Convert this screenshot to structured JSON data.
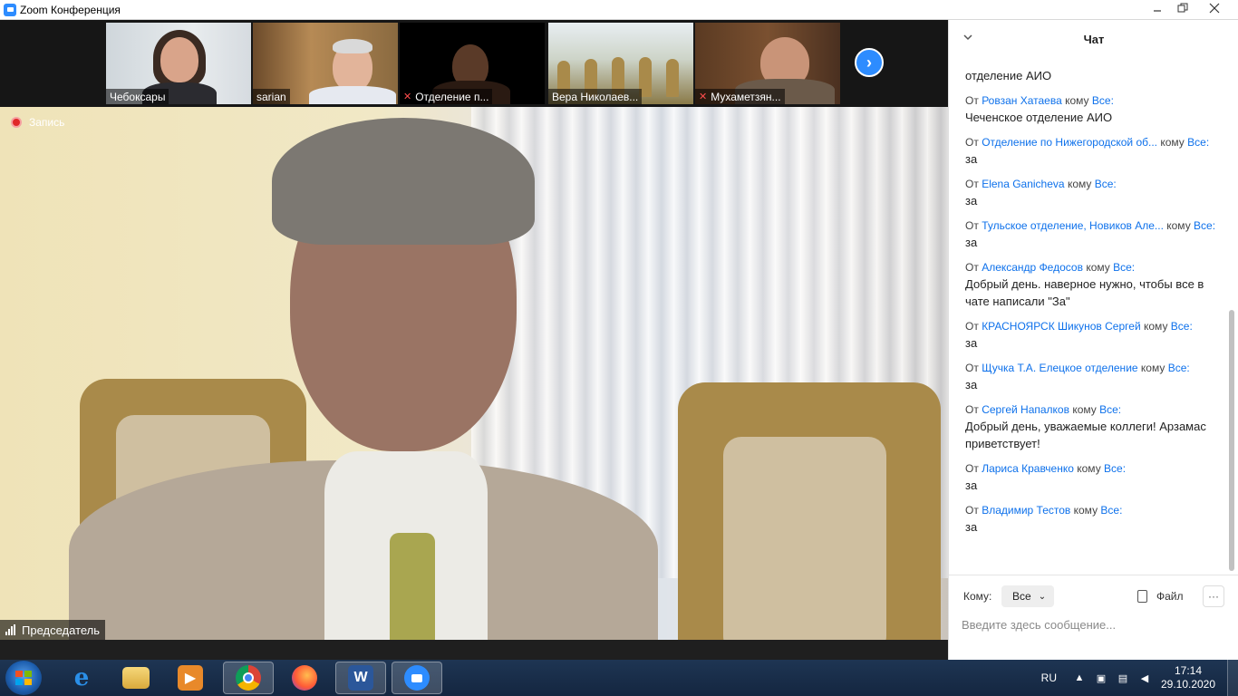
{
  "window": {
    "title": "Zoom Конференция"
  },
  "colors": {
    "accent": "#2d8cff",
    "link": "#0e71eb",
    "record": "#e02828",
    "taskbar": "#1e3553"
  },
  "participants": [
    {
      "name": "Чебоксары",
      "muted": false
    },
    {
      "name": "sarian",
      "muted": false
    },
    {
      "name": "Отделение п...",
      "muted": true
    },
    {
      "name": "Вера Николаев...",
      "muted": false
    },
    {
      "name": "Мухаметзян...",
      "muted": true
    }
  ],
  "main_video": {
    "recording_label": "Запись",
    "speaker_label": "Председатель"
  },
  "chat": {
    "title": "Чат",
    "partial_top": "отделение АИО",
    "from_word": "От",
    "to_word": "кому",
    "messages": [
      {
        "from": "Ровзан Хатаева",
        "to": "Все:",
        "text": "Чеченское отделение АИО"
      },
      {
        "from": "Отделение по Нижегородской об...",
        "to": "Все:",
        "text": "за"
      },
      {
        "from": "Elena Ganicheva",
        "to": "Все:",
        "text": "за"
      },
      {
        "from": "Тульское отделение, Новиков Але...",
        "to": "Все:",
        "text": "за"
      },
      {
        "from": "Александр Федосов",
        "to": "Все:",
        "text": "Добрый день. наверное нужно, чтобы все в чате написали \"За\""
      },
      {
        "from": "КРАСНОЯРСК Шикунов Сергей",
        "to": "Все:",
        "text": "за"
      },
      {
        "from": "Щучка Т.А. Елецкое отделение",
        "to": "Все:",
        "text": "за"
      },
      {
        "from": "Сергей Напалков",
        "to": "Все:",
        "text": "Добрый день, уважаемые коллеги! Арзамас приветствует!"
      },
      {
        "from": "Лариса Кравченко",
        "to": "Все:",
        "text": "за"
      },
      {
        "from": "Владимир Тестов",
        "to": "Все:",
        "text": "за"
      }
    ],
    "footer": {
      "to_label": "Кому:",
      "to_value": "Все",
      "file_label": "Файл",
      "more_label": "···",
      "input_placeholder": "Введите здесь сообщение..."
    }
  },
  "taskbar": {
    "lang": "RU",
    "time": "17:14",
    "date": "29.10.2020",
    "word_letter": "W"
  }
}
